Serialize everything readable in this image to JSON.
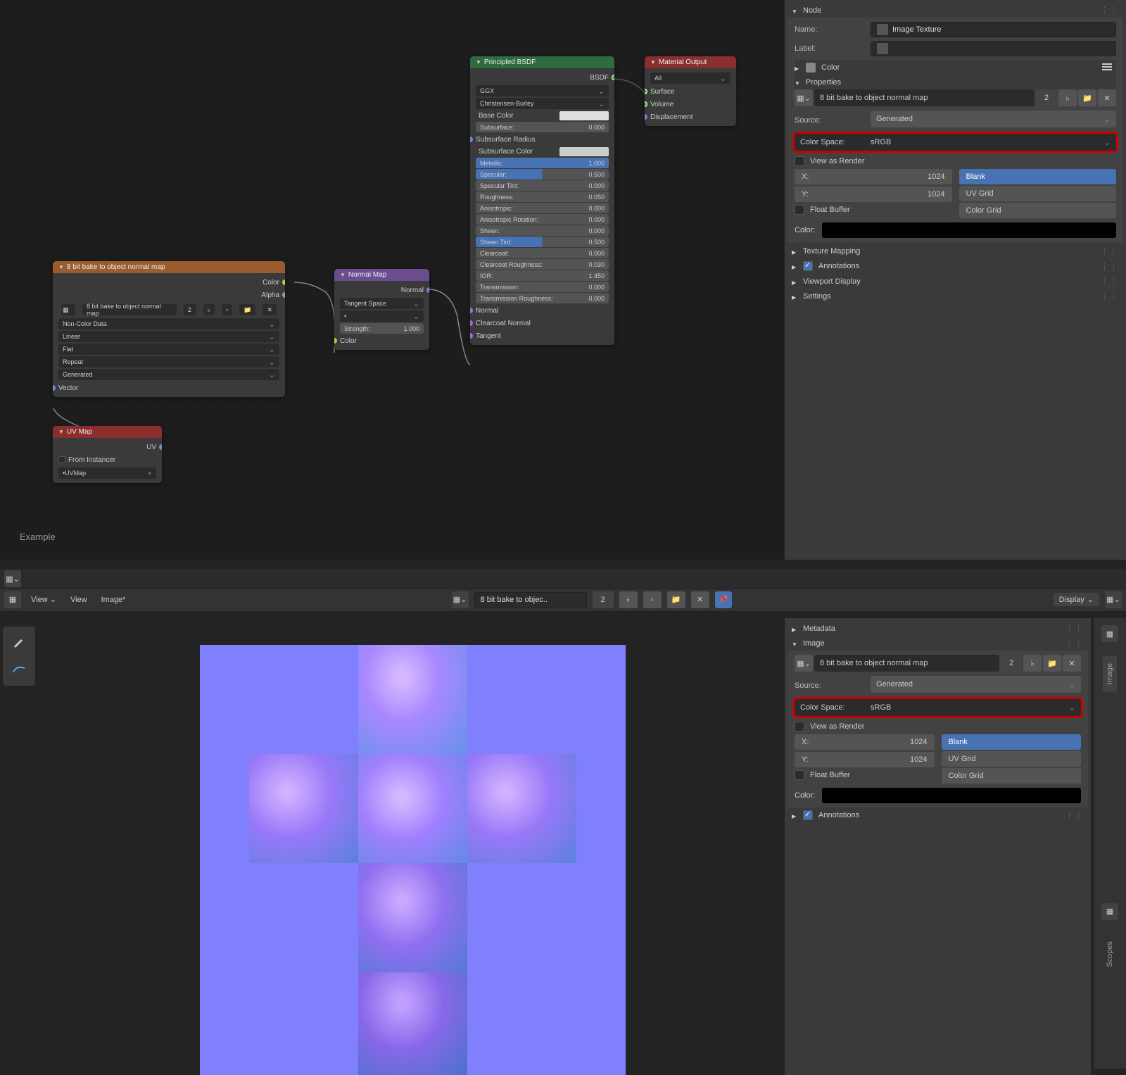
{
  "sidepanel": {
    "node_section": "Node",
    "name_label": "Name:",
    "name_value": "Image Texture",
    "label_label": "Label:",
    "color_label": "Color",
    "properties_label": "Properties",
    "img_name": "8 bit bake to object normal map",
    "img_users": "2",
    "source_label": "Source:",
    "source_value": "Generated",
    "colorspace_label": "Color Space:",
    "colorspace_value": "sRGB",
    "view_as_render": "View as Render",
    "x_label": "X:",
    "x_value": "1024",
    "y_label": "Y:",
    "y_value": "1024",
    "blank": "Blank",
    "uv_grid": "UV Grid",
    "color_grid": "Color Grid",
    "float_buffer": "Float Buffer",
    "color_label2": "Color:",
    "texture_mapping": "Texture Mapping",
    "annotations": "Annotations",
    "viewport_display": "Viewport Display",
    "settings": "Settings"
  },
  "bottompanel": {
    "metadata": "Metadata",
    "image": "Image",
    "img_name": "8 bit bake to object normal map",
    "img_users": "2",
    "source_label": "Source:",
    "source_value": "Generated",
    "colorspace_label": "Color Space:",
    "colorspace_value": "sRGB",
    "view_as_render": "View as Render",
    "x_label": "X:",
    "x_value": "1024",
    "y_label": "Y:",
    "y_value": "1024",
    "blank": "Blank",
    "uv_grid": "UV Grid",
    "color_grid": "Color Grid",
    "float_buffer": "Float Buffer",
    "color_label2": "Color:",
    "annotations": "Annotations"
  },
  "nodes": {
    "img_tex": {
      "title": "8 bit bake to object normal map",
      "color_out": "Color",
      "alpha_out": "Alpha",
      "img_name": "8 bit bake to object normal map",
      "img_users": "2",
      "colorspace": "Non-Color Data",
      "interp": "Linear",
      "proj": "Flat",
      "ext": "Repeat",
      "source": "Generated",
      "vector_in": "Vector"
    },
    "uv_map": {
      "title": "UV Map",
      "uv_out": "UV",
      "from_instancer": "From Instancer",
      "map_name": "UVMap"
    },
    "normal_map": {
      "title": "Normal Map",
      "normal_out": "Normal",
      "space": "Tangent Space",
      "strength_label": "Strength:",
      "strength_val": "1.000",
      "color_in": "Color"
    },
    "principled": {
      "title": "Principled BSDF",
      "bsdf_out": "BSDF",
      "dist": "GGX",
      "sss_method": "Christensen-Burley",
      "base_color": "Base Color",
      "subsurface": "Subsurface:",
      "subsurface_v": "0.000",
      "subsurface_radius": "Subsurface Radius",
      "subsurface_color": "Subsurface Color",
      "metallic": "Metallic:",
      "metallic_v": "1.000",
      "specular": "Specular:",
      "specular_v": "0.500",
      "specular_tint": "Specular Tint:",
      "specular_tint_v": "0.000",
      "roughness": "Roughness:",
      "roughness_v": "0.050",
      "anisotropic": "Anisotropic:",
      "anisotropic_v": "0.000",
      "aniso_rot": "Anisotropic Rotation:",
      "aniso_rot_v": "0.000",
      "sheen": "Sheen:",
      "sheen_v": "0.000",
      "sheen_tint": "Sheen Tint:",
      "sheen_tint_v": "0.500",
      "clearcoat": "Clearcoat:",
      "clearcoat_v": "0.000",
      "clearcoat_rough": "Clearcoat Roughness:",
      "clearcoat_rough_v": "0.030",
      "ior": "IOR:",
      "ior_v": "1.450",
      "transmission": "Transmission:",
      "transmission_v": "0.000",
      "trans_rough": "Transmission Roughness:",
      "trans_rough_v": "0.000",
      "normal_in": "Normal",
      "clearcoat_normal": "Clearcoat Normal",
      "tangent": "Tangent"
    },
    "mat_output": {
      "title": "Material Output",
      "target": "All",
      "surface": "Surface",
      "volume": "Volume",
      "displacement": "Displacement"
    }
  },
  "example_label": "Example",
  "toolbar": {
    "view": "View",
    "view2": "View",
    "image": "Image*",
    "img_name": "8 bit bake to objec..",
    "img_users": "2",
    "display": "Display"
  },
  "tabs": {
    "image": "Image",
    "scopes": "Scopes"
  }
}
